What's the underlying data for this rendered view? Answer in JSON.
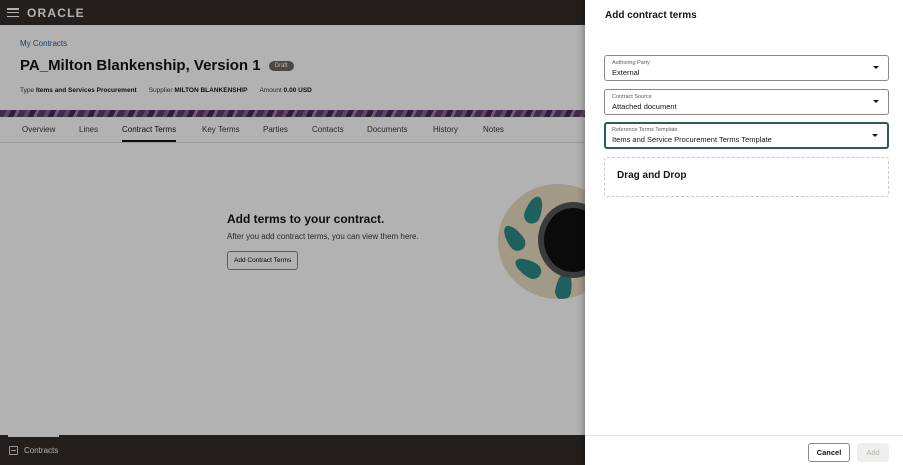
{
  "app": {
    "brand": "ORACLE"
  },
  "breadcrumb": "My Contracts",
  "page": {
    "title": "PA_Milton Blankenship, Version 1",
    "status": "Draft",
    "meta": {
      "type_label": "Type",
      "type_value": "Items and Services Procurement",
      "supplier_label": "Supplier",
      "supplier_value": "MILTON BLANKENSHIP",
      "amount_label": "Amount",
      "amount_value": "0.00 USD"
    }
  },
  "tabs": [
    {
      "label": "Overview"
    },
    {
      "label": "Lines"
    },
    {
      "label": "Contract Terms",
      "active": true
    },
    {
      "label": "Key Terms"
    },
    {
      "label": "Parties"
    },
    {
      "label": "Contacts"
    },
    {
      "label": "Documents"
    },
    {
      "label": "History"
    },
    {
      "label": "Notes"
    }
  ],
  "empty_state": {
    "title": "Add terms to your contract.",
    "subtitle": "After you add contract terms, you can view them here.",
    "button": "Add Contract Terms"
  },
  "footer": {
    "label": "Contracts",
    "icon": "contracts-icon"
  },
  "drawer": {
    "title": "Add contract terms",
    "fields": {
      "authoring_party": {
        "label": "Authoring Party",
        "value": "External"
      },
      "contract_source": {
        "label": "Contract Source",
        "value": "Attached document"
      },
      "reference_template": {
        "label": "Reference Terms Template",
        "value": "Items and Service Procurement Terms Template"
      }
    },
    "dropzone": "Drag and Drop",
    "buttons": {
      "cancel": "Cancel",
      "add": "Add"
    }
  },
  "colors": {
    "header": "#312d2a",
    "focus": "#2c5967",
    "link": "#2b5d8f"
  }
}
